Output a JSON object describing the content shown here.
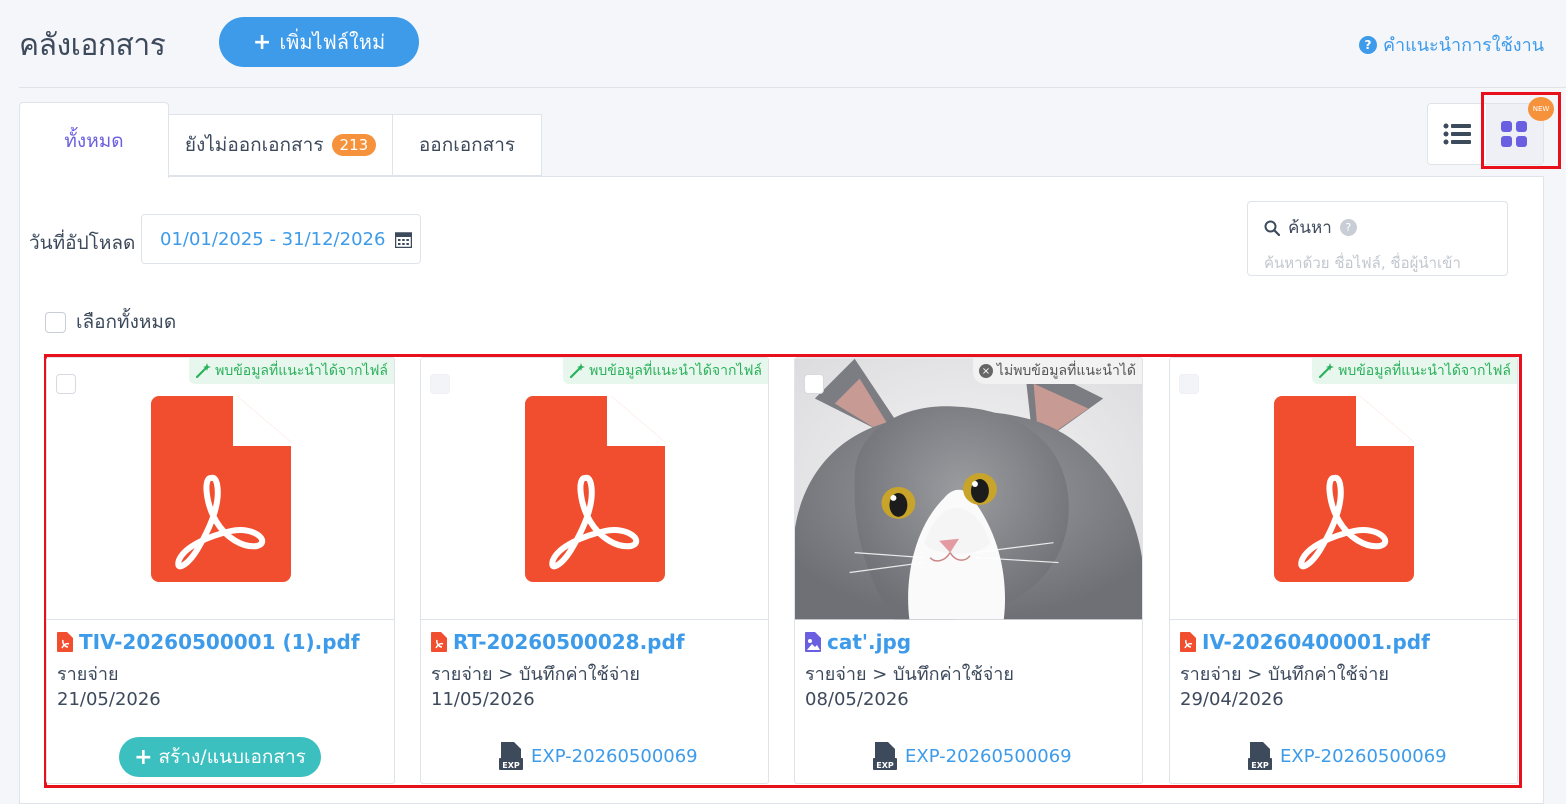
{
  "header": {
    "title": "คลังเอกสาร",
    "add_button": "เพิ่มไฟล์ใหม่",
    "help_link": "คำแนะนำการใช้งาน"
  },
  "tabs": [
    {
      "label": "ทั้งหมด",
      "active": true
    },
    {
      "label": "ยังไม่ออกเอกสาร",
      "badge": "213"
    },
    {
      "label": "ออกเอกสาร"
    }
  ],
  "view_toggle": {
    "selected": "grid",
    "new_badge": "NEW"
  },
  "filters": {
    "date_label": "วันที่อัปโหลด",
    "date_range": "01/01/2025 - 31/12/2026",
    "search_label": "ค้นหา",
    "search_placeholder": "ค้นหาด้วย ชื่อไฟล์, ชื่อผู้นำเข้า"
  },
  "select_all_label": "เลือกทั้งหมด",
  "cards": [
    {
      "filename": "TIV-20260500001 (1).pdf",
      "type": "pdf",
      "path": "รายจ่าย",
      "date": "21/05/2026",
      "ai_tag": "พบข้อมูลที่แนะนำได้จากไฟล์",
      "action": "สร้าง/แนบเอกสาร"
    },
    {
      "filename": "RT-20260500028.pdf",
      "type": "pdf",
      "path": "รายจ่าย > บันทึกค่าใช้จ่าย",
      "date": "11/05/2026",
      "ai_tag": "พบข้อมูลที่แนะนำได้จากไฟล์",
      "doc_link": "EXP-20260500069"
    },
    {
      "filename": "cat'.jpg",
      "type": "image",
      "path": "รายจ่าย > บันทึกค่าใช้จ่าย",
      "date": "08/05/2026",
      "ai_tag": "ไม่พบข้อมูลที่แนะนำได้",
      "doc_link": "EXP-20260500069"
    },
    {
      "filename": "IV-20260400001.pdf",
      "type": "pdf",
      "path": "รายจ่าย > บันทึกค่าใช้จ่าย",
      "date": "29/04/2026",
      "ai_tag": "พบข้อมูลที่แนะนำได้จากไฟล์",
      "doc_link": "EXP-20260500069"
    }
  ],
  "colors": {
    "accent": "#3d9bea",
    "pdf": "#f04e2f",
    "teal": "#3cbfbf",
    "highlight": "#e8111b"
  }
}
